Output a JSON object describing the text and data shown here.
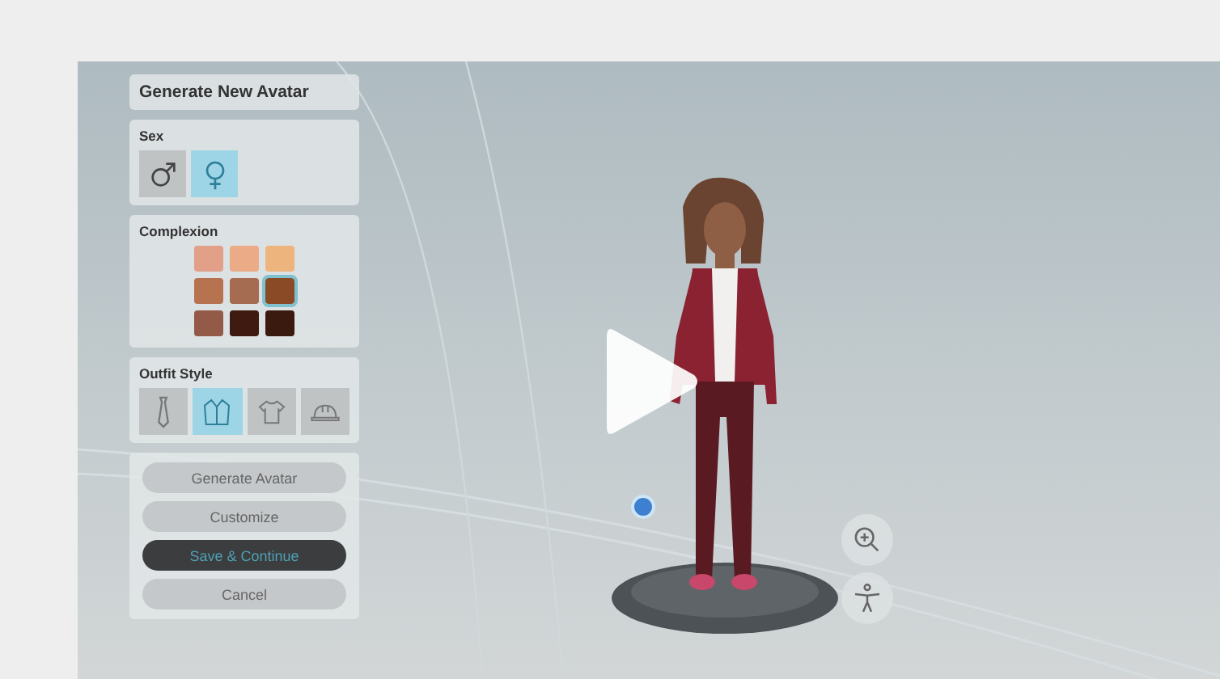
{
  "panel_title": "Generate New Avatar",
  "sex": {
    "label": "Sex",
    "options": [
      {
        "kind": "male",
        "selected": false
      },
      {
        "kind": "female",
        "selected": true
      }
    ]
  },
  "complexion": {
    "label": "Complexion",
    "swatches": [
      {
        "color": "#e3a088",
        "selected": false
      },
      {
        "color": "#eaab86",
        "selected": false
      },
      {
        "color": "#edb47e",
        "selected": false
      },
      {
        "color": "#b7734f",
        "selected": false
      },
      {
        "color": "#a56c52",
        "selected": false
      },
      {
        "color": "#8a4a26",
        "selected": true
      },
      {
        "color": "#935a48",
        "selected": false
      },
      {
        "color": "#3e1a10",
        "selected": false
      },
      {
        "color": "#3a1a0e",
        "selected": false
      }
    ]
  },
  "outfit": {
    "label": "Outfit Style",
    "options": [
      {
        "kind": "tie",
        "selected": false
      },
      {
        "kind": "jacket",
        "selected": true
      },
      {
        "kind": "tshirt",
        "selected": false
      },
      {
        "kind": "hardhat",
        "selected": false
      }
    ]
  },
  "buttons": [
    {
      "label": "Generate Avatar",
      "kind": "default"
    },
    {
      "label": "Customize",
      "kind": "default"
    },
    {
      "label": "Save & Continue",
      "kind": "primary"
    },
    {
      "label": "Cancel",
      "kind": "default"
    }
  ]
}
